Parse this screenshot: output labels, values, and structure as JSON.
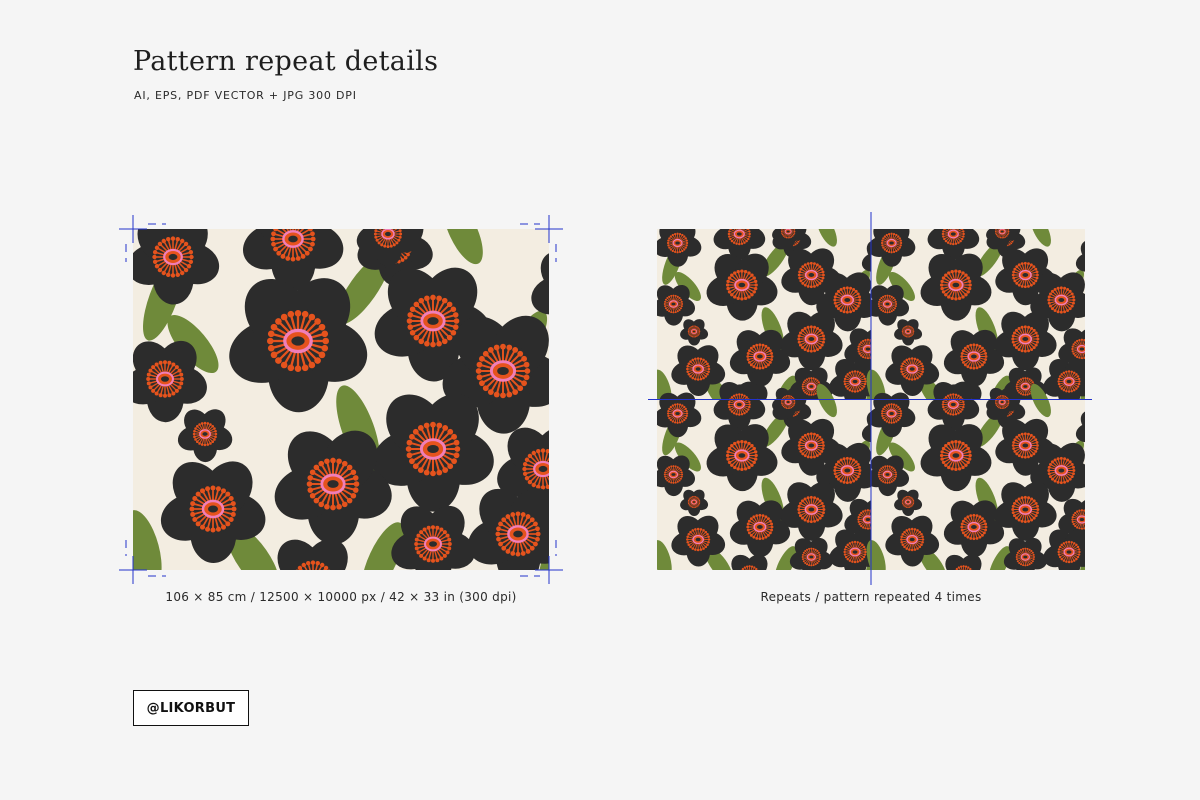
{
  "header": {
    "title": "Pattern repeat details",
    "formats": "AI, EPS, PDF VECTOR + JPG 300 DPI"
  },
  "panels": {
    "single": {
      "caption": "106 × 85 cm / 12500 × 10000 px / 42 × 33 in (300 dpi)"
    },
    "repeat": {
      "caption": "Repeats / pattern repeated 4 times",
      "repeat_count": 4
    }
  },
  "brand": {
    "logo_text": "@LIKORBUT"
  },
  "colors": {
    "page_bg": "#f5f5f5",
    "pattern_bg": "#f3ede1",
    "petal": "#2c2c2c",
    "leaf": "#6f8a3a",
    "stamen": "#e5531d",
    "center_ring": "#f07fb9",
    "guide": "#2233cc"
  }
}
